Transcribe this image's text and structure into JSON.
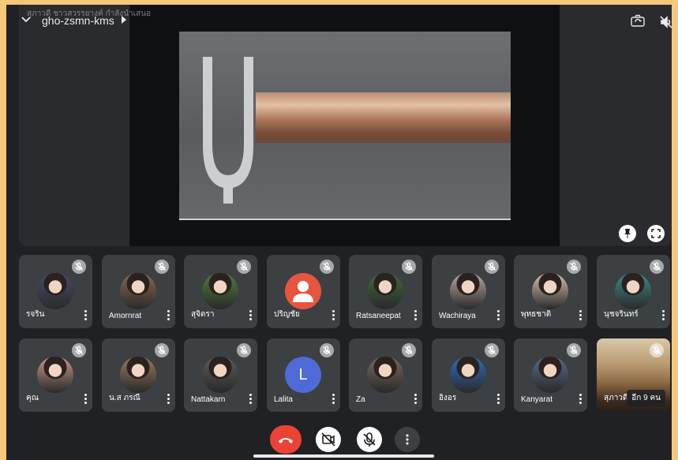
{
  "header": {
    "presenter_caption": "สุภาวดี ชาวสวรรยางค์ กำลังนำเสนอ",
    "meeting_code": "gho-zsmn-kms"
  },
  "participants": [
    {
      "name": "รจริน",
      "avatar": "photo",
      "color": "#4a4a6a",
      "muted": true
    },
    {
      "name": "Amornrat",
      "avatar": "photo",
      "color": "#8a6a52",
      "muted": true
    },
    {
      "name": "สุจิตรา",
      "avatar": "photo",
      "color": "#4f7d3c",
      "muted": true
    },
    {
      "name": "ปริญชัย",
      "avatar": "default-person",
      "color": "#e8553f",
      "muted": true
    },
    {
      "name": "Ratsaneepat",
      "avatar": "photo",
      "color": "#3d6b3a",
      "muted": true
    },
    {
      "name": "Wachiraya",
      "avatar": "photo",
      "color": "#b8a8a6",
      "muted": true
    },
    {
      "name": "พุทธชาติ",
      "avatar": "photo",
      "color": "#d8c2a8",
      "muted": true
    },
    {
      "name": "นุชจรินทร์",
      "avatar": "photo",
      "color": "#3e8a8a",
      "muted": true
    },
    {
      "name": "คุณ",
      "avatar": "photo",
      "color": "#c49a86",
      "muted": true
    },
    {
      "name": "น.ส ภรณี",
      "avatar": "photo",
      "color": "#9a7a5a",
      "muted": true
    },
    {
      "name": "Nattakarn",
      "avatar": "photo",
      "color": "#5a5a5a",
      "muted": true
    },
    {
      "name": "Lalita",
      "avatar": "initial",
      "initial": "L",
      "color": "#4f6bd8",
      "muted": true
    },
    {
      "name": "Za",
      "avatar": "photo",
      "color": "#7a6a5a",
      "muted": true
    },
    {
      "name": "อิงอร",
      "avatar": "photo",
      "color": "#2f6fc0",
      "muted": true
    },
    {
      "name": "Kanyarat",
      "avatar": "photo",
      "color": "#5a6a8a",
      "muted": true
    }
  ],
  "overflow_tile": {
    "name": "สุภาวดี",
    "more_label": "อีก 9 คน",
    "muted": true
  },
  "colors": {
    "end_call": "#ea4335",
    "tile_bg": "#3c4043",
    "frame_bg": "#202124",
    "outer_bg": "#f4c77a"
  },
  "icons": {
    "collapse": "chevron-down-icon",
    "switch_camera": "switch-camera-icon",
    "speaker": "speaker-off-icon",
    "pin": "pin-icon",
    "fullscreen": "fullscreen-icon",
    "end_call": "phone-hangup-icon",
    "camera": "camera-off-icon",
    "mic": "mic-off-icon",
    "more": "more-vert-icon"
  }
}
